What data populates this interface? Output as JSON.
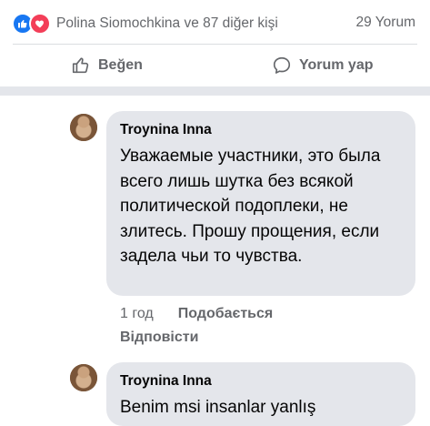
{
  "header": {
    "reaction_icons": [
      "like-icon",
      "love-icon"
    ],
    "reactions_text": "Polina Siomochkina ve 87 diğer kişi",
    "comments_count": "29 Yorum",
    "like_label": "Beğen",
    "comment_label": "Yorum yap"
  },
  "comments": [
    {
      "author": "Troynina Inna",
      "text": "Уважаемые участники, это была всего лишь шутка без всякой политической подоплеки, не злитесь. Прошу прощения, если задела чьи то чувства.",
      "time": "1 год",
      "like": "Подобається",
      "reply": "Відповісти"
    },
    {
      "author": "Troynina Inna",
      "text": "Benim msi insanlar yanlış"
    }
  ],
  "colors": {
    "like_blue": "#1877f2",
    "love_red": "#f33e58",
    "bubble_bg": "#e4e6eb",
    "muted": "#65676b"
  }
}
